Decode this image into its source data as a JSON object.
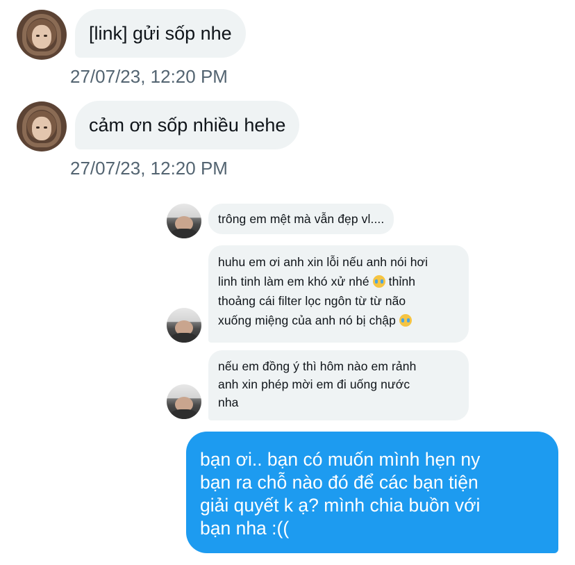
{
  "messages_in_top": [
    {
      "text": "[link] gửi sốp nhe",
      "timestamp": "27/07/23, 12:20 PM"
    },
    {
      "text": "cảm ơn sốp nhiều hehe",
      "timestamp": "27/07/23, 12:20 PM"
    }
  ],
  "quoted_thread": {
    "msg1": "trông em mệt mà vẫn đẹp vl....",
    "msg2_lines": [
      "huhu em ơi anh xin lỗi nếu anh nói hơi",
      "linh tinh làm em khó xử nhé",
      "thỉnh",
      "thoảng cái filter lọc ngôn từ từ não",
      "xuống miệng của anh nó bị chập"
    ],
    "msg3_lines": [
      "nếu em đồng ý thì hôm nào em rảnh",
      "anh xin phép mời em đi uống nước",
      "nha"
    ],
    "emoji_name": "loudly-crying-face-emoji"
  },
  "message_out_lines": [
    "bạn ơi.. bạn có muốn mình hẹn ny",
    "bạn ra chỗ nào đó để các bạn tiện",
    "giải quyết k ạ? mình chia buồn với",
    "bạn nha :(("
  ],
  "colors": {
    "incoming_bubble": "#eff3f4",
    "outgoing_bubble": "#1d9bf0",
    "timestamp": "#536471"
  }
}
